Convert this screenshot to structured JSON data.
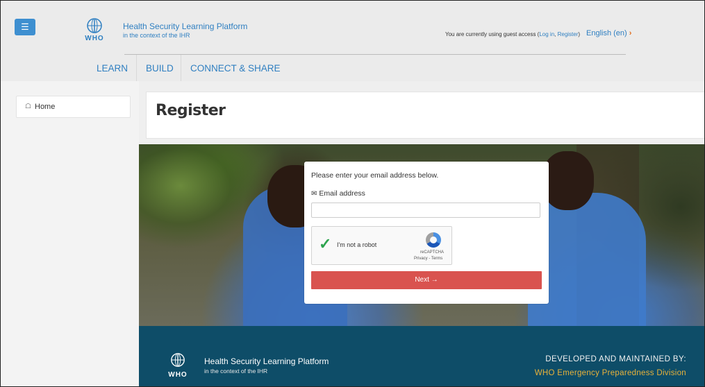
{
  "header": {
    "menu_icon": "hamburger-icon",
    "logo_text": "WHO",
    "brand_title": "Health Security Learning Platform",
    "brand_subtitle": "in the context of the IHR",
    "guest_prefix": "You are currently using guest access (",
    "login_link": "Log in",
    "guest_comma": ", ",
    "register_link": "Register",
    "guest_suffix": ")",
    "language": "English (en)",
    "language_caret": "›"
  },
  "nav": {
    "items": [
      "LEARN",
      "BUILD",
      "CONNECT & SHARE"
    ]
  },
  "sidebar": {
    "home_icon": "home-icon",
    "home_label": "Home"
  },
  "main": {
    "page_title": "Register"
  },
  "form": {
    "prompt": "Please enter your email address below.",
    "email_label": "Email address",
    "email_value": "",
    "captcha_label": "I'm not a robot",
    "captcha_brand": "reCAPTCHA",
    "captcha_terms": "Privacy - Terms",
    "next_button": "Next →"
  },
  "footer": {
    "logo_text": "WHO",
    "title": "Health Security Learning Platform",
    "subtitle": "in the context of the IHR",
    "developed_by": "DEVELOPED AND MAINTAINED BY:",
    "division": "WHO Emergency Preparedness Division"
  },
  "colors": {
    "brand_blue": "#2f7fc1",
    "next_button": "#d9534f",
    "footer_bg": "#0e4d68",
    "footer_accent": "#e9b23a"
  }
}
